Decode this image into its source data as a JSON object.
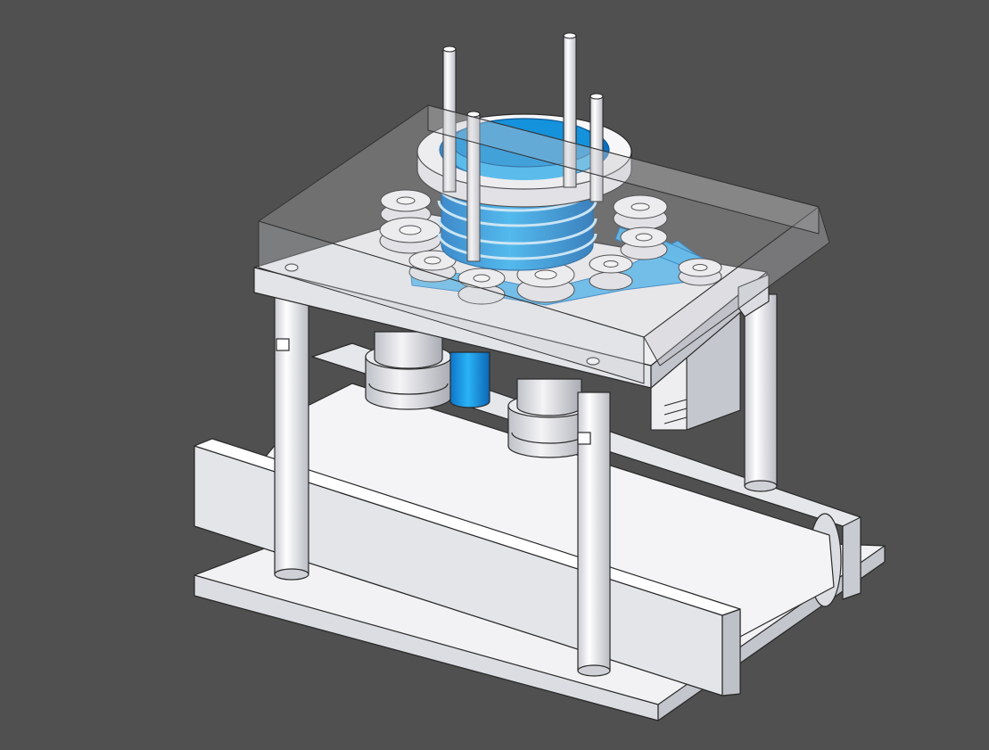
{
  "viewport": {
    "background_color": "#505050",
    "render_style": "shaded-with-edges, isometric CAD view"
  },
  "model": {
    "colors": {
      "body_white": "#f4f4f6",
      "shade_light": "#d9dae0",
      "shade_mid": "#b8bac2",
      "edge_dark": "#2a2a2a",
      "accent_blue": "#1aa3ee",
      "accent_blue_dark": "#0b6fbf",
      "cover_glass": "#cfd0d4"
    },
    "parts": [
      "base-plate",
      "conveyor-belt",
      "support-column",
      "mounting-plate",
      "transparent-cover",
      "blue-sleeve-cylinder",
      "clamp-ring",
      "guide-rod",
      "timing-pulley",
      "timing-belt",
      "lower-spindle-housing",
      "drive-motor"
    ]
  }
}
